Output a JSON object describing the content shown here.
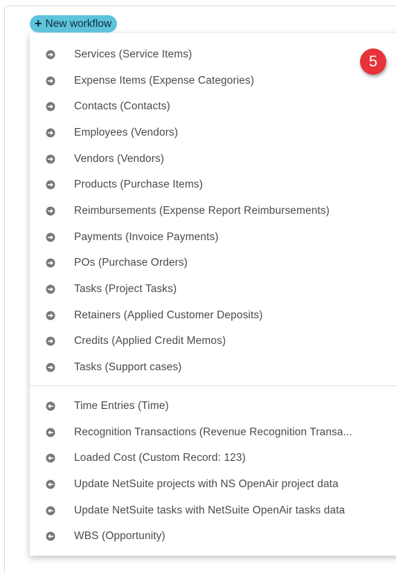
{
  "header": {
    "new_workflow_label": "New workflow",
    "plus_glyph": "+"
  },
  "badge": {
    "number": "5",
    "color": "#e8333a"
  },
  "colors": {
    "button_bg": "#5fc3dc",
    "icon_fill": "#777777"
  },
  "menu": {
    "group_one": [
      {
        "label": "Services (Service Items)",
        "icon": "arrow-right-circle-icon"
      },
      {
        "label": "Expense Items (Expense Categories)",
        "icon": "arrow-right-circle-icon"
      },
      {
        "label": "Contacts (Contacts)",
        "icon": "arrow-right-circle-icon"
      },
      {
        "label": "Employees (Vendors)",
        "icon": "arrow-right-circle-icon"
      },
      {
        "label": "Vendors (Vendors)",
        "icon": "arrow-right-circle-icon"
      },
      {
        "label": "Products (Purchase Items)",
        "icon": "arrow-right-circle-icon"
      },
      {
        "label": "Reimbursements (Expense Report Reimbursements)",
        "icon": "arrow-right-circle-icon"
      },
      {
        "label": "Payments (Invoice Payments)",
        "icon": "arrow-right-circle-icon"
      },
      {
        "label": "POs (Purchase Orders)",
        "icon": "arrow-right-circle-icon"
      },
      {
        "label": "Tasks (Project Tasks)",
        "icon": "arrow-right-circle-icon"
      },
      {
        "label": "Retainers (Applied Customer Deposits)",
        "icon": "arrow-right-circle-icon"
      },
      {
        "label": "Credits (Applied Credit Memos)",
        "icon": "arrow-right-circle-icon"
      },
      {
        "label": "Tasks (Support cases)",
        "icon": "arrow-right-circle-icon"
      }
    ],
    "group_two": [
      {
        "label": "Time Entries (Time)",
        "icon": "arrow-left-circle-icon"
      },
      {
        "label": "Recognition Transactions (Revenue Recognition Transa...",
        "icon": "arrow-left-circle-icon"
      },
      {
        "label": "Loaded Cost (Custom Record: 123)",
        "icon": "arrow-left-circle-icon"
      },
      {
        "label": "Update NetSuite projects with NS OpenAir project data",
        "icon": "arrow-left-circle-icon"
      },
      {
        "label": "Update NetSuite tasks with NetSuite OpenAir tasks data",
        "icon": "arrow-left-circle-icon"
      },
      {
        "label": "WBS (Opportunity)",
        "icon": "arrow-left-circle-icon"
      }
    ]
  }
}
